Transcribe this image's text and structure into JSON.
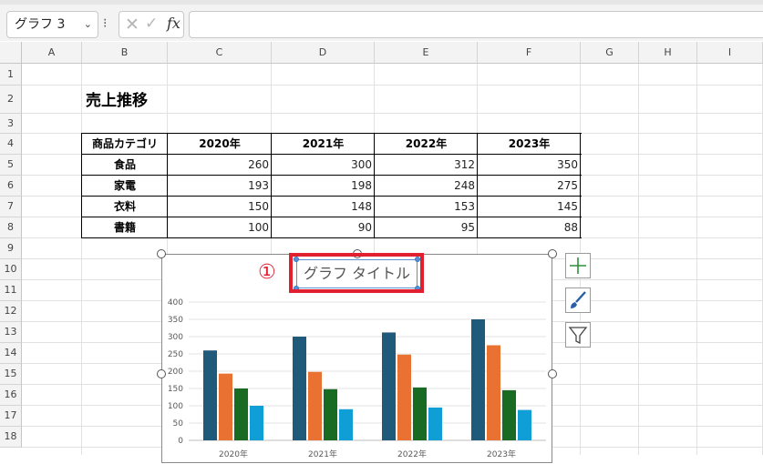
{
  "formula_bar": {
    "name_box": "グラフ 3",
    "more_symbol": "⁝",
    "cancel_symbol": "✕",
    "enter_symbol": "✓",
    "fx_symbol": "fx",
    "formula_value": ""
  },
  "columns": [
    "A",
    "B",
    "C",
    "D",
    "E",
    "F",
    "G",
    "H",
    "I"
  ],
  "rows": [
    "1",
    "2",
    "3",
    "4",
    "5",
    "6",
    "7",
    "8",
    "9",
    "10",
    "11",
    "12",
    "13",
    "14",
    "15",
    "16",
    "17",
    "18"
  ],
  "sheet_title": "売上推移",
  "table": {
    "headers": [
      "商品カテゴリ",
      "2020年",
      "2021年",
      "2022年",
      "2023年"
    ],
    "rows": [
      [
        "食品",
        "260",
        "300",
        "312",
        "350"
      ],
      [
        "家電",
        "193",
        "198",
        "248",
        "275"
      ],
      [
        "衣料",
        "150",
        "148",
        "153",
        "145"
      ],
      [
        "書籍",
        "100",
        "90",
        "95",
        "88"
      ]
    ]
  },
  "chart": {
    "title_placeholder": "グラフ タイトル",
    "callout_number": "①"
  },
  "chart_data": {
    "type": "bar",
    "categories": [
      "2020年",
      "2021年",
      "2022年",
      "2023年"
    ],
    "series": [
      {
        "values": [
          260,
          300,
          312,
          350
        ],
        "color": "#1f5a7a"
      },
      {
        "values": [
          193,
          198,
          248,
          275
        ],
        "color": "#e97132"
      },
      {
        "values": [
          150,
          148,
          153,
          145
        ],
        "color": "#196b24"
      },
      {
        "values": [
          100,
          90,
          95,
          88
        ],
        "color": "#0f9ed5"
      }
    ],
    "ylim": [
      0,
      400
    ],
    "yticks": [
      "0",
      "50",
      "100",
      "150",
      "200",
      "250",
      "300",
      "350",
      "400"
    ],
    "grid": true
  },
  "side_buttons": [
    "plus-icon",
    "brush-icon",
    "filter-icon"
  ],
  "colors": {
    "accent": "#5b8fd1",
    "highlight": "#e0202f"
  }
}
